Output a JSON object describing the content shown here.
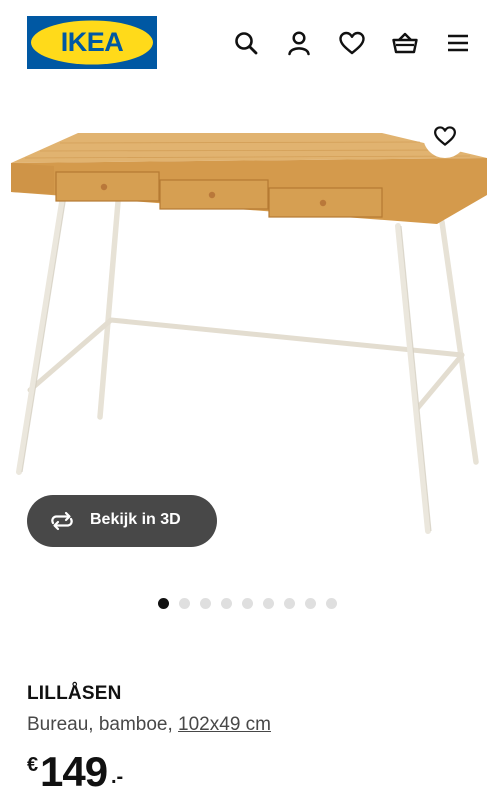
{
  "header": {
    "logo_text": "IKEA",
    "icons": [
      "search-icon",
      "account-icon",
      "heart-icon",
      "basket-icon",
      "menu-icon"
    ]
  },
  "hero": {
    "image": "bamboo-desk-with-white-legs",
    "favorite_icon": "heart-icon",
    "view_3d_label": "Bekijk in 3D",
    "view_3d_icon": "rotate-3d-icon"
  },
  "carousel": {
    "total": 9,
    "active": 1
  },
  "product": {
    "name": "LILLÅSEN",
    "description": "Bureau, bamboe,",
    "dimensions": "102x49 cm",
    "price": {
      "currency": "€",
      "integer": "149",
      "decimal": ".-"
    }
  },
  "colors": {
    "brand_blue": "#0058a3",
    "brand_yellow": "#ffda1a",
    "button_dark": "#484848",
    "dot_active": "#111111",
    "dot_inactive": "#dfdfdf",
    "bamboo": "#d9a456"
  }
}
